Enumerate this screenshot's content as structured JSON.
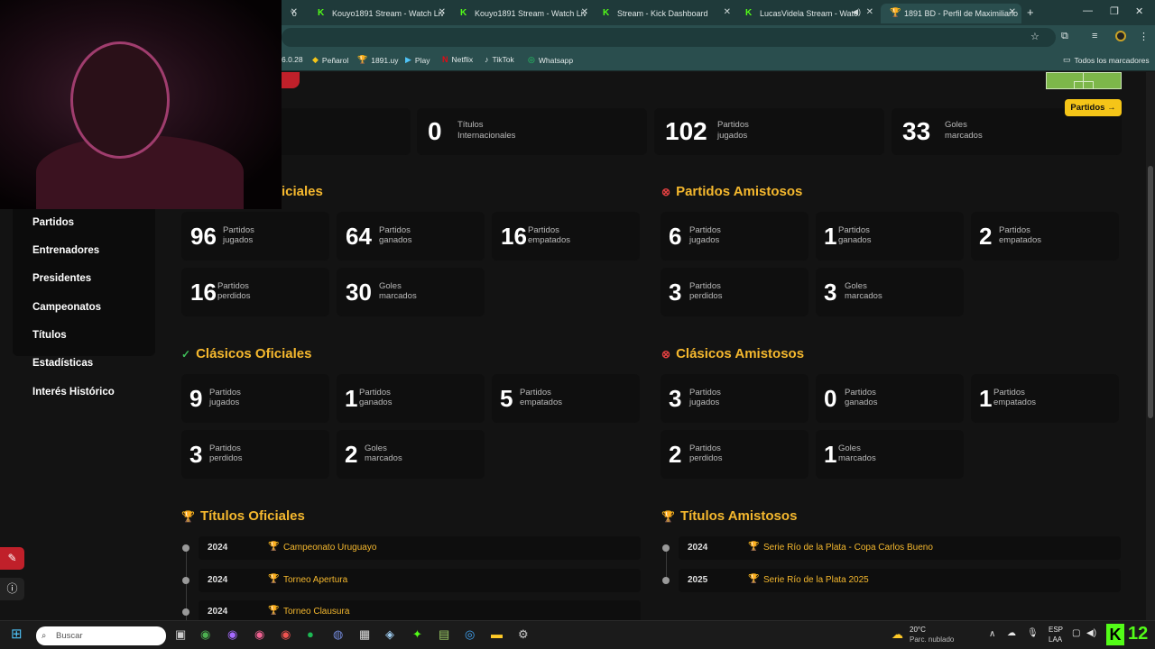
{
  "browser": {
    "tabs": [
      {
        "label": "Kouyo1891 Stream - Watch Liv",
        "icon": "kick-icon"
      },
      {
        "label": "Kouyo1891 Stream - Watch Liv",
        "icon": "kick-icon"
      },
      {
        "label": "Stream - Kick Dashboard",
        "icon": "kick-icon"
      },
      {
        "label": "LucasVidela Stream - Watc",
        "icon": "kick-icon"
      },
      {
        "label": "1891 BD - Perfil de Maximiliano",
        "icon": "trophy-icon"
      }
    ],
    "bookmarks": [
      {
        "label": "6.0.28"
      },
      {
        "label": "Peñarol"
      },
      {
        "label": "1891.uy"
      },
      {
        "label": "Play"
      },
      {
        "label": "Netflix"
      },
      {
        "label": "TikTok"
      },
      {
        "label": "Whatsapp"
      }
    ],
    "all_bookmarks": "Todos los marcadores"
  },
  "header_stats": [
    {
      "value": "0",
      "label_line1": "Títulos",
      "label_line2": "Internacionales"
    },
    {
      "value": "102",
      "label_line1": "Partidos",
      "label_line2": "jugados"
    },
    {
      "value": "33",
      "label_line1": "Goles",
      "label_line2": "marcados"
    }
  ],
  "partidos_button": "Partidos →",
  "sidebar": {
    "items": [
      "Partidos",
      "Entrenadores",
      "Presidentes",
      "Campeonatos",
      "Títulos",
      "Estadísticas",
      "Interés Histórico"
    ]
  },
  "sections": {
    "oficiales": {
      "title": "iciales",
      "cards": [
        {
          "value": "96",
          "l1": "Partidos",
          "l2": "jugados"
        },
        {
          "value": "64",
          "l1": "Partidos",
          "l2": "ganados"
        },
        {
          "value": "16",
          "l1": "Partidos",
          "l2": "empatados"
        },
        {
          "value": "16",
          "l1": "Partidos",
          "l2": "perdidos"
        },
        {
          "value": "30",
          "l1": "Goles",
          "l2": "marcados"
        }
      ]
    },
    "amistosos": {
      "title": "Partidos Amistosos",
      "cards": [
        {
          "value": "6",
          "l1": "Partidos",
          "l2": "jugados"
        },
        {
          "value": "1",
          "l1": "Partidos",
          "l2": "ganados"
        },
        {
          "value": "2",
          "l1": "Partidos",
          "l2": "empatados"
        },
        {
          "value": "3",
          "l1": "Partidos",
          "l2": "perdidos"
        },
        {
          "value": "3",
          "l1": "Goles",
          "l2": "marcados"
        }
      ]
    },
    "clasicos_oficiales": {
      "title": "Clásicos Oficiales",
      "cards": [
        {
          "value": "9",
          "l1": "Partidos",
          "l2": "jugados"
        },
        {
          "value": "1",
          "l1": "Partidos",
          "l2": "ganados"
        },
        {
          "value": "5",
          "l1": "Partidos",
          "l2": "empatados"
        },
        {
          "value": "3",
          "l1": "Partidos",
          "l2": "perdidos"
        },
        {
          "value": "2",
          "l1": "Goles",
          "l2": "marcados"
        }
      ]
    },
    "clasicos_amistosos": {
      "title": "Clásicos Amistosos",
      "cards": [
        {
          "value": "3",
          "l1": "Partidos",
          "l2": "jugados"
        },
        {
          "value": "0",
          "l1": "Partidos",
          "l2": "ganados"
        },
        {
          "value": "1",
          "l1": "Partidos",
          "l2": "empatados"
        },
        {
          "value": "2",
          "l1": "Partidos",
          "l2": "perdidos"
        },
        {
          "value": "1",
          "l1": "Goles",
          "l2": "marcados"
        }
      ]
    },
    "titulos_oficiales": {
      "title": "Títulos Oficiales",
      "items": [
        {
          "year": "2024",
          "name": "Campeonato Uruguayo"
        },
        {
          "year": "2024",
          "name": "Torneo Apertura"
        },
        {
          "year": "2024",
          "name": "Torneo Clausura"
        }
      ]
    },
    "titulos_amistosos": {
      "title": "Títulos Amistosos",
      "items": [
        {
          "year": "2024",
          "name": "Serie Río de la Plata - Copa Carlos Bueno"
        },
        {
          "year": "2025",
          "name": "Serie Río de la Plata 2025"
        }
      ]
    }
  },
  "taskbar": {
    "search_placeholder": "Buscar",
    "weather_temp": "20°C",
    "weather_desc": "Parc. nublado",
    "lang_line1": "ESP",
    "lang_line2": "LAA",
    "kick_count": "12"
  }
}
